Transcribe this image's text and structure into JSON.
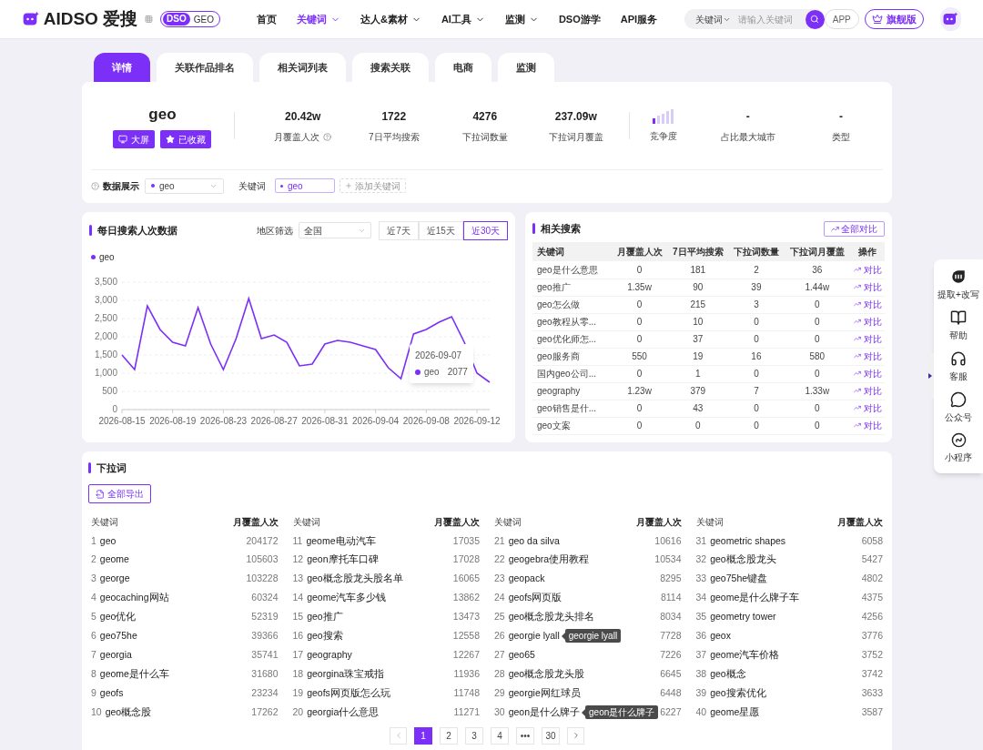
{
  "header": {
    "logo": "AIDSO 爱搜",
    "badge": {
      "left": "DSO",
      "right": "GEO"
    },
    "nav": [
      {
        "label": "首页",
        "selected": false,
        "dropdown": false
      },
      {
        "label": "关键词",
        "selected": true,
        "dropdown": true
      },
      {
        "label": "达人&素材",
        "selected": false,
        "dropdown": true
      },
      {
        "label": "AI工具",
        "selected": false,
        "dropdown": true
      },
      {
        "label": "监测",
        "selected": false,
        "dropdown": true
      },
      {
        "label": "DSO游学",
        "selected": false,
        "dropdown": false
      },
      {
        "label": "API服务",
        "selected": false,
        "dropdown": false
      }
    ],
    "search": {
      "scope": "关键词",
      "placeholder": "请输入关键词"
    },
    "app_button": "APP",
    "vip_button": "旗舰版"
  },
  "tabs": [
    {
      "label": "详情",
      "selected": true
    },
    {
      "label": "关联作品排名",
      "selected": false
    },
    {
      "label": "相关词列表",
      "selected": false
    },
    {
      "label": "搜索关联",
      "selected": false
    },
    {
      "label": "电商",
      "selected": false
    },
    {
      "label": "监测",
      "selected": false
    }
  ],
  "summary": {
    "keyword": "geo",
    "buttons": [
      {
        "kind": "screen",
        "label": "大屏"
      },
      {
        "kind": "star",
        "label": "已收藏"
      }
    ],
    "stats": [
      {
        "value": "20.42w",
        "label": "月覆盖人次",
        "help": true
      },
      {
        "value": "1722",
        "label": "7日平均搜索",
        "help": false
      },
      {
        "value": "4276",
        "label": "下拉词数量",
        "help": false
      },
      {
        "value": "237.09w",
        "label": "下拉词月覆盖",
        "help": false
      }
    ],
    "competition": {
      "label": "竞争度",
      "level": 0.2
    },
    "extra": [
      {
        "value": "-",
        "label": "占比最大城市"
      },
      {
        "value": "-",
        "label": "类型"
      }
    ]
  },
  "filter": {
    "label": "数据展示",
    "select": "geo",
    "keyword_label": "关键词",
    "tags": [
      "geo"
    ],
    "add_button": "添加关键词"
  },
  "daily": {
    "title": "每日搜索人次数据",
    "region_label": "地区筛选",
    "region": "全国",
    "ranges": [
      {
        "label": "近7天",
        "selected": false
      },
      {
        "label": "近15天",
        "selected": false
      },
      {
        "label": "近30天",
        "selected": true
      }
    ],
    "tooltip": {
      "date": "2026-09-07",
      "series": "geo",
      "value": "2077"
    },
    "chart_data": {
      "type": "line",
      "categories": [
        "2026-08-15",
        null,
        null,
        null,
        "2026-08-19",
        null,
        null,
        null,
        "2026-08-23",
        null,
        null,
        null,
        "2026-08-27",
        null,
        null,
        null,
        "2026-08-31",
        null,
        null,
        null,
        "2026-09-04",
        null,
        null,
        null,
        "2026-09-08",
        null,
        null,
        null,
        "2026-09-12",
        null
      ],
      "series": [
        {
          "name": "geo",
          "color": "#7b2ff7",
          "values": [
            1500,
            1100,
            2850,
            2200,
            1850,
            1750,
            2800,
            1800,
            1100,
            1950,
            3050,
            1950,
            2050,
            1850,
            1200,
            1250,
            1800,
            1900,
            1850,
            1750,
            1650,
            1150,
            850,
            2077,
            2200,
            2400,
            2550,
            1850,
            1000,
            750
          ]
        }
      ],
      "ylim": [
        0,
        3500
      ],
      "grid": true,
      "yticks": [
        {
          "value": 0,
          "label": "0"
        },
        {
          "value": 500,
          "label": "500"
        },
        {
          "value": 1000,
          "label": "1,000"
        },
        {
          "value": 1500,
          "label": "1,500"
        },
        {
          "value": 2000,
          "label": "2,000"
        },
        {
          "value": 2500,
          "label": "2,500"
        },
        {
          "value": 3000,
          "label": "3,000"
        },
        {
          "value": 3500,
          "label": "3,500"
        }
      ]
    }
  },
  "related": {
    "title": "相关搜索",
    "compare_all": "全部对比",
    "columns": [
      "关键词",
      "月覆盖人次",
      "7日平均搜索",
      "下拉词数量",
      "下拉词月覆盖",
      "操作"
    ],
    "rows": [
      [
        "geo是什么意思",
        "0",
        "181",
        "2",
        "36",
        "对比"
      ],
      [
        "geo推广",
        "1.35w",
        "90",
        "39",
        "1.44w",
        "对比"
      ],
      [
        "geo怎么做",
        "0",
        "215",
        "3",
        "0",
        "对比"
      ],
      [
        "geo教程从零...",
        "0",
        "10",
        "0",
        "0",
        "对比"
      ],
      [
        "geo优化师怎...",
        "0",
        "37",
        "0",
        "0",
        "对比"
      ],
      [
        "geo服务商",
        "550",
        "19",
        "16",
        "580",
        "对比"
      ],
      [
        "国内geo公司...",
        "0",
        "1",
        "0",
        "0",
        "对比"
      ],
      [
        "geography",
        "1.23w",
        "379",
        "7",
        "1.33w",
        "对比"
      ],
      [
        "geo销售是什...",
        "0",
        "43",
        "0",
        "0",
        "对比"
      ],
      [
        "geo文案",
        "0",
        "0",
        "0",
        "0",
        "对比"
      ]
    ]
  },
  "dropdown_words": {
    "title": "下拉词",
    "export_button": "全部导出",
    "groups": [
      {
        "columns": [
          "关键词",
          "月覆盖人次"
        ],
        "rows": [
          {
            "rank": "1",
            "keyword": "geo",
            "value": "204172"
          },
          {
            "rank": "2",
            "keyword": "geome",
            "value": "105603"
          },
          {
            "rank": "3",
            "keyword": "george",
            "value": "103228"
          },
          {
            "rank": "4",
            "keyword": "geocaching网站",
            "value": "60324"
          },
          {
            "rank": "5",
            "keyword": "geo优化",
            "value": "52319"
          },
          {
            "rank": "6",
            "keyword": "geo75he",
            "value": "39366"
          },
          {
            "rank": "7",
            "keyword": "georgia",
            "value": "35741"
          },
          {
            "rank": "8",
            "keyword": "geome是什么车",
            "value": "31680"
          },
          {
            "rank": "9",
            "keyword": "geofs",
            "value": "23234"
          },
          {
            "rank": "10",
            "keyword": "geo概念股",
            "value": "17262"
          }
        ]
      },
      {
        "columns": [
          "关键词",
          "月覆盖人次"
        ],
        "rows": [
          {
            "rank": "11",
            "keyword": "geome电动汽车",
            "value": "17035"
          },
          {
            "rank": "12",
            "keyword": "geon摩托车口碑",
            "value": "17028"
          },
          {
            "rank": "13",
            "keyword": "geo概念股龙头股名单",
            "value": "16065"
          },
          {
            "rank": "14",
            "keyword": "geome汽车多少钱",
            "value": "13862"
          },
          {
            "rank": "15",
            "keyword": "geo推广",
            "value": "13473"
          },
          {
            "rank": "16",
            "keyword": "geo搜索",
            "value": "12558"
          },
          {
            "rank": "17",
            "keyword": "geography",
            "value": "12267"
          },
          {
            "rank": "18",
            "keyword": "georgina珠宝戒指",
            "value": "11936"
          },
          {
            "rank": "19",
            "keyword": "geofs网页版怎么玩",
            "value": "11748"
          },
          {
            "rank": "20",
            "keyword": "georgia什么意思",
            "value": "11271"
          }
        ]
      },
      {
        "columns": [
          "关键词",
          "月覆盖人次"
        ],
        "rows": [
          {
            "rank": "21",
            "keyword": "geo da silva",
            "value": "10616"
          },
          {
            "rank": "22",
            "keyword": "geogebra使用教程",
            "value": "10534"
          },
          {
            "rank": "23",
            "keyword": "geopack",
            "value": "8295"
          },
          {
            "rank": "24",
            "keyword": "geofs网页版",
            "value": "8114"
          },
          {
            "rank": "25",
            "keyword": "geo概念股龙头排名",
            "value": "8034"
          },
          {
            "rank": "26",
            "keyword": "georgie lyall",
            "value": "7728",
            "tooltip": "georgie lyall"
          },
          {
            "rank": "27",
            "keyword": "geo65",
            "value": "7226"
          },
          {
            "rank": "28",
            "keyword": "geo概念股龙头股",
            "value": "6645"
          },
          {
            "rank": "29",
            "keyword": "georgie网红球员",
            "value": "6448"
          },
          {
            "rank": "30",
            "keyword": "geon是什么牌子",
            "value": "6227",
            "tooltip": "geon是什么牌子"
          }
        ]
      },
      {
        "columns": [
          "关键词",
          "月覆盖人次"
        ],
        "rows": [
          {
            "rank": "31",
            "keyword": "geometric shapes",
            "value": "6058"
          },
          {
            "rank": "32",
            "keyword": "geo概念股龙头",
            "value": "5427"
          },
          {
            "rank": "33",
            "keyword": "geo75he键盘",
            "value": "4802"
          },
          {
            "rank": "34",
            "keyword": "geome是什么牌子车",
            "value": "4375"
          },
          {
            "rank": "35",
            "keyword": "geometry tower",
            "value": "4256"
          },
          {
            "rank": "36",
            "keyword": "geox",
            "value": "3776"
          },
          {
            "rank": "37",
            "keyword": "geome汽车价格",
            "value": "3752"
          },
          {
            "rank": "38",
            "keyword": "geo概念",
            "value": "3742"
          },
          {
            "rank": "39",
            "keyword": "geo搜索优化",
            "value": "3633"
          },
          {
            "rank": "40",
            "keyword": "geome星愿",
            "value": "3587"
          }
        ]
      }
    ],
    "pagination": [
      {
        "label": "1",
        "selected": true
      },
      {
        "label": "2",
        "selected": false
      },
      {
        "label": "3",
        "selected": false
      },
      {
        "label": "4",
        "selected": false
      },
      {
        "label": "•••",
        "selected": false
      },
      {
        "label": "30",
        "selected": false
      }
    ]
  },
  "side_panel": [
    {
      "kind": "ai",
      "label": "提取+改写"
    },
    {
      "kind": "book",
      "label": "帮助"
    },
    {
      "kind": "headset",
      "label": "客服"
    },
    {
      "kind": "chat",
      "label": "公众号"
    },
    {
      "kind": "mini",
      "label": "小程序"
    }
  ]
}
